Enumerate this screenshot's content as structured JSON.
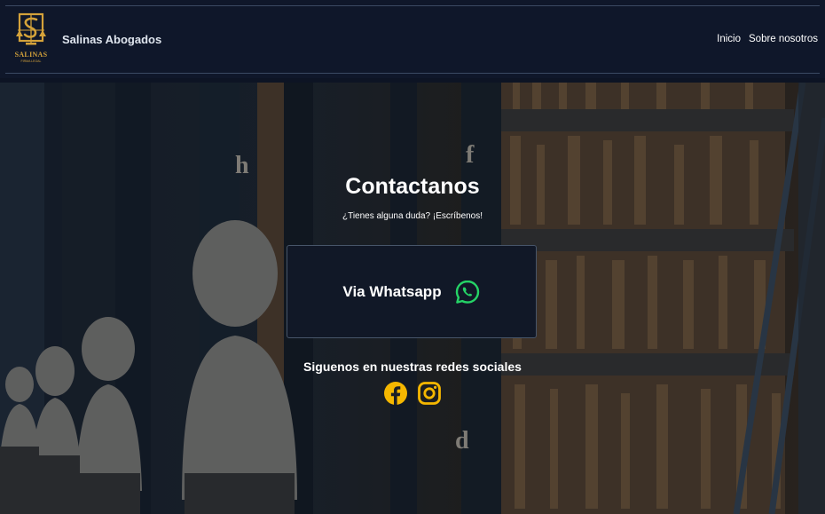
{
  "navbar": {
    "logo_text": "SALINAS",
    "logo_subtext": "FIRMA LEGAL",
    "brand": "Salinas Abogados",
    "links": [
      "Inicio",
      "Sobre nosotros"
    ]
  },
  "hero": {
    "title": "Contactanos",
    "subtitle": "¿Tienes alguna duda? ¡Escríbenos!",
    "whatsapp_label": "Via Whatsapp",
    "whatsapp_icon": "whatsapp-icon",
    "social_title": "Siguenos en nuestras redes sociales",
    "social_icons": [
      "facebook-icon",
      "instagram-icon"
    ]
  },
  "colors": {
    "navbar_bg": "#0f172a",
    "card_bg": "#111827",
    "accent_gold": "#f5b700",
    "logo_gold": "#d4a23a",
    "whatsapp_green": "#25d366"
  }
}
